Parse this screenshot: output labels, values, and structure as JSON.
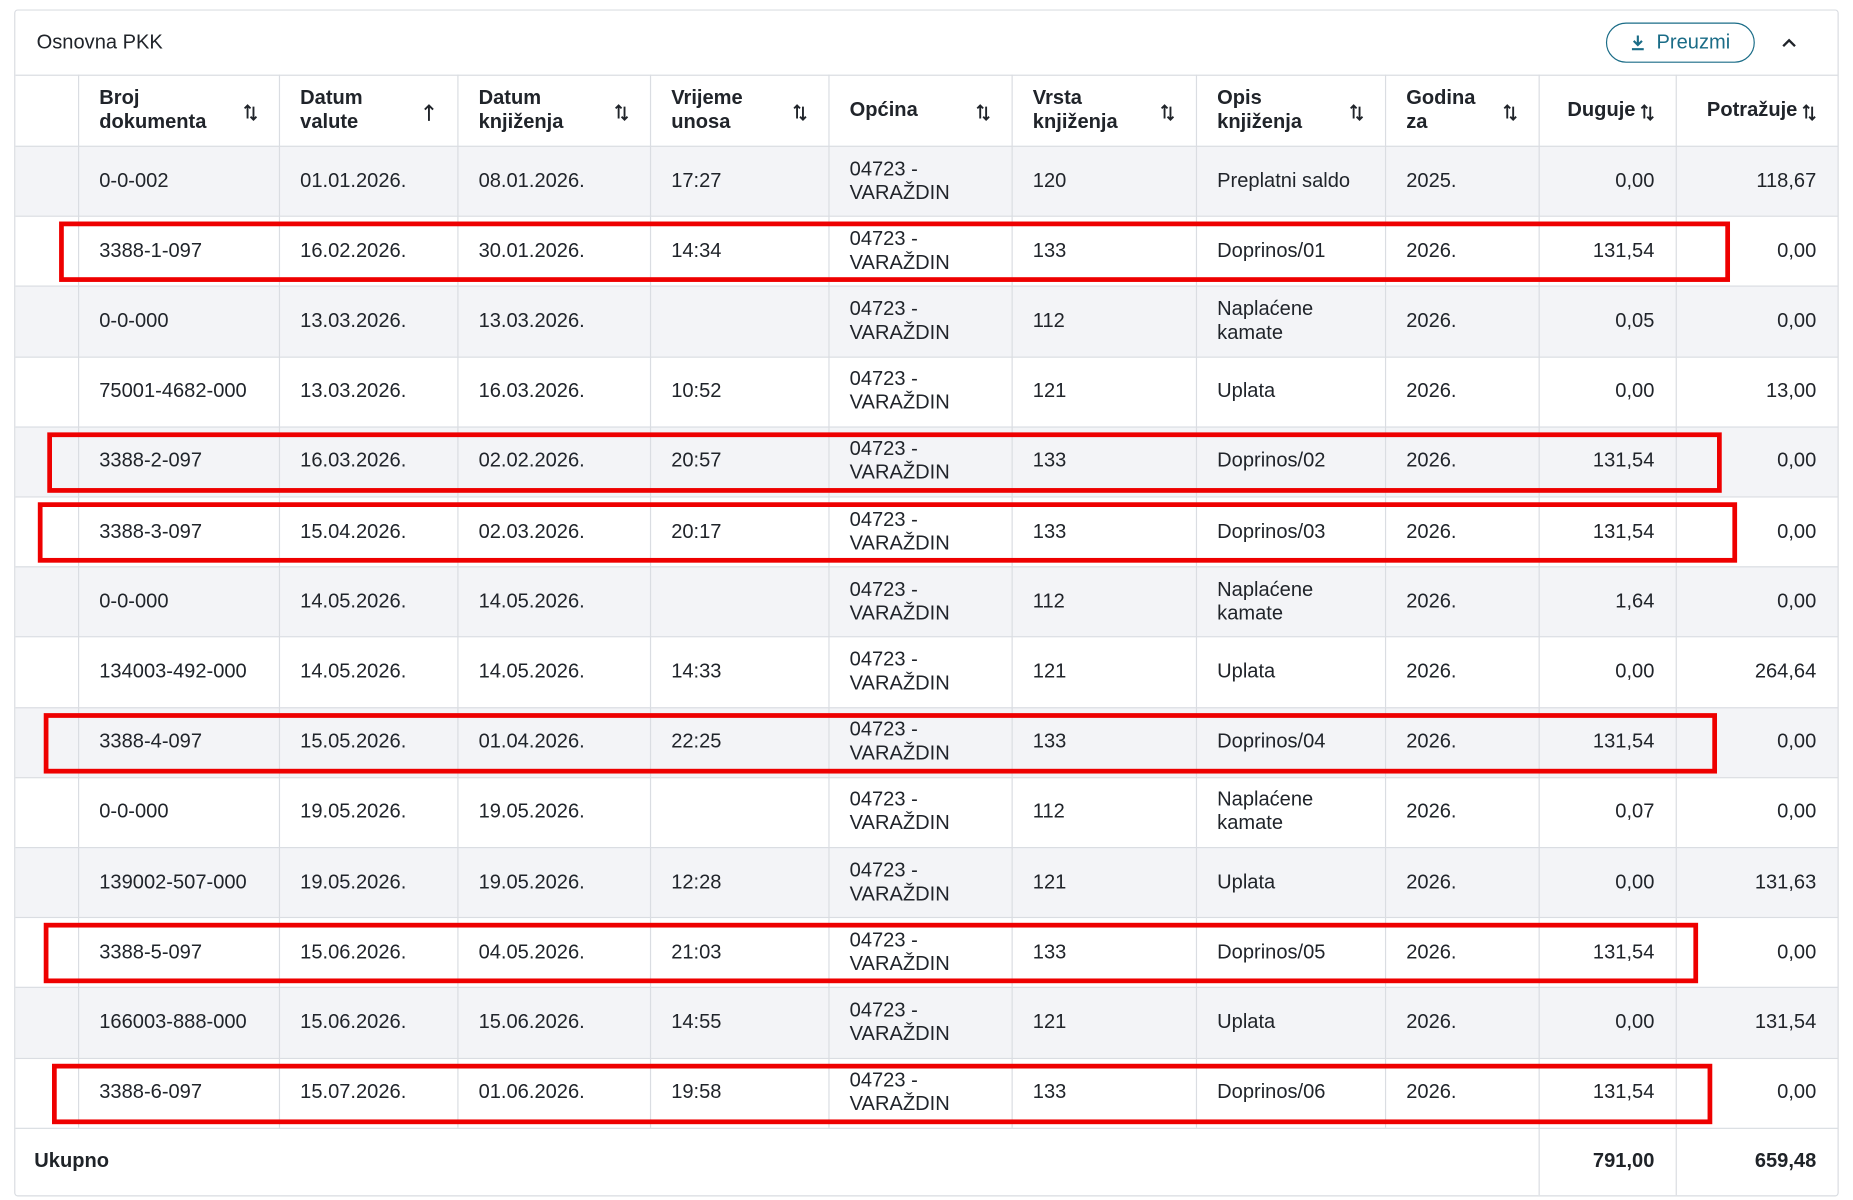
{
  "panel": {
    "title": "Osnovna PKK",
    "download_label": "Preuzmi"
  },
  "columns": [
    {
      "key": "select",
      "label": ""
    },
    {
      "key": "broj",
      "label": "Broj\ndokumenta",
      "sort": "both"
    },
    {
      "key": "datum_valute",
      "label": "Datum\nvalute",
      "sort": "asc"
    },
    {
      "key": "datum_knjizenja",
      "label": "Datum\nknjiženja",
      "sort": "both"
    },
    {
      "key": "vrijeme",
      "label": "Vrijeme\nunosa",
      "sort": "both"
    },
    {
      "key": "opcina",
      "label": "Općina",
      "sort": "both"
    },
    {
      "key": "vrsta",
      "label": "Vrsta\nknjiženja",
      "sort": "both"
    },
    {
      "key": "opis",
      "label": "Opis\nknjiženja",
      "sort": "both"
    },
    {
      "key": "godina",
      "label": "Godina\nza",
      "sort": "both"
    },
    {
      "key": "duguje",
      "label": "Duguje",
      "sort": "both"
    },
    {
      "key": "potrazuje",
      "label": "Potražuje",
      "sort": "both"
    }
  ],
  "rows": [
    {
      "broj": "0-0-002",
      "datum_valute": "01.01.2026.",
      "datum_knjizenja": "08.01.2026.",
      "vrijeme": "17:27",
      "opcina": "04723 -\nVARAŽDIN",
      "vrsta": "120",
      "opis": "Preplatni saldo",
      "godina": "2025.",
      "duguje": "0,00",
      "potrazuje": "118,67",
      "highlighted": false
    },
    {
      "broj": "3388-1-097",
      "datum_valute": "16.02.2026.",
      "datum_knjizenja": "30.01.2026.",
      "vrijeme": "14:34",
      "opcina": "04723 -\nVARAŽDIN",
      "vrsta": "133",
      "opis": "Doprinos/01",
      "godina": "2026.",
      "duguje": "131,54",
      "potrazuje": "0,00",
      "highlighted": true
    },
    {
      "broj": "0-0-000",
      "datum_valute": "13.03.2026.",
      "datum_knjizenja": "13.03.2026.",
      "vrijeme": "",
      "opcina": "04723 -\nVARAŽDIN",
      "vrsta": "112",
      "opis": "Naplaćene\nkamate",
      "godina": "2026.",
      "duguje": "0,05",
      "potrazuje": "0,00",
      "highlighted": false
    },
    {
      "broj": "75001-4682-000",
      "datum_valute": "13.03.2026.",
      "datum_knjizenja": "16.03.2026.",
      "vrijeme": "10:52",
      "opcina": "04723 -\nVARAŽDIN",
      "vrsta": "121",
      "opis": "Uplata",
      "godina": "2026.",
      "duguje": "0,00",
      "potrazuje": "13,00",
      "highlighted": false
    },
    {
      "broj": "3388-2-097",
      "datum_valute": "16.03.2026.",
      "datum_knjizenja": "02.02.2026.",
      "vrijeme": "20:57",
      "opcina": "04723 -\nVARAŽDIN",
      "vrsta": "133",
      "opis": "Doprinos/02",
      "godina": "2026.",
      "duguje": "131,54",
      "potrazuje": "0,00",
      "highlighted": true
    },
    {
      "broj": "3388-3-097",
      "datum_valute": "15.04.2026.",
      "datum_knjizenja": "02.03.2026.",
      "vrijeme": "20:17",
      "opcina": "04723 -\nVARAŽDIN",
      "vrsta": "133",
      "opis": "Doprinos/03",
      "godina": "2026.",
      "duguje": "131,54",
      "potrazuje": "0,00",
      "highlighted": true
    },
    {
      "broj": "0-0-000",
      "datum_valute": "14.05.2026.",
      "datum_knjizenja": "14.05.2026.",
      "vrijeme": "",
      "opcina": "04723 -\nVARAŽDIN",
      "vrsta": "112",
      "opis": "Naplaćene\nkamate",
      "godina": "2026.",
      "duguje": "1,64",
      "potrazuje": "0,00",
      "highlighted": false
    },
    {
      "broj": "134003-492-000",
      "datum_valute": "14.05.2026.",
      "datum_knjizenja": "14.05.2026.",
      "vrijeme": "14:33",
      "opcina": "04723 -\nVARAŽDIN",
      "vrsta": "121",
      "opis": "Uplata",
      "godina": "2026.",
      "duguje": "0,00",
      "potrazuje": "264,64",
      "highlighted": false
    },
    {
      "broj": "3388-4-097",
      "datum_valute": "15.05.2026.",
      "datum_knjizenja": "01.04.2026.",
      "vrijeme": "22:25",
      "opcina": "04723 -\nVARAŽDIN",
      "vrsta": "133",
      "opis": "Doprinos/04",
      "godina": "2026.",
      "duguje": "131,54",
      "potrazuje": "0,00",
      "highlighted": true
    },
    {
      "broj": "0-0-000",
      "datum_valute": "19.05.2026.",
      "datum_knjizenja": "19.05.2026.",
      "vrijeme": "",
      "opcina": "04723 -\nVARAŽDIN",
      "vrsta": "112",
      "opis": "Naplaćene\nkamate",
      "godina": "2026.",
      "duguje": "0,07",
      "potrazuje": "0,00",
      "highlighted": false
    },
    {
      "broj": "139002-507-000",
      "datum_valute": "19.05.2026.",
      "datum_knjizenja": "19.05.2026.",
      "vrijeme": "12:28",
      "opcina": "04723 -\nVARAŽDIN",
      "vrsta": "121",
      "opis": "Uplata",
      "godina": "2026.",
      "duguje": "0,00",
      "potrazuje": "131,63",
      "highlighted": false
    },
    {
      "broj": "3388-5-097",
      "datum_valute": "15.06.2026.",
      "datum_knjizenja": "04.05.2026.",
      "vrijeme": "21:03",
      "opcina": "04723 -\nVARAŽDIN",
      "vrsta": "133",
      "opis": "Doprinos/05",
      "godina": "2026.",
      "duguje": "131,54",
      "potrazuje": "0,00",
      "highlighted": true
    },
    {
      "broj": "166003-888-000",
      "datum_valute": "15.06.2026.",
      "datum_knjizenja": "15.06.2026.",
      "vrijeme": "14:55",
      "opcina": "04723 -\nVARAŽDIN",
      "vrsta": "121",
      "opis": "Uplata",
      "godina": "2026.",
      "duguje": "0,00",
      "potrazuje": "131,54",
      "highlighted": false
    },
    {
      "broj": "3388-6-097",
      "datum_valute": "15.07.2026.",
      "datum_knjizenja": "01.06.2026.",
      "vrijeme": "19:58",
      "opcina": "04723 -\nVARAŽDIN",
      "vrsta": "133",
      "opis": "Doprinos/06",
      "godina": "2026.",
      "duguje": "131,54",
      "potrazuje": "0,00",
      "highlighted": true
    }
  ],
  "footer": {
    "label": "Ukupno",
    "duguje_total": "791,00",
    "potrazuje_total": "659,48"
  },
  "colors": {
    "accent": "#1a6c87",
    "highlight": "#ee0000",
    "row_alt": "#f3f4f7",
    "border": "#dadde2"
  }
}
